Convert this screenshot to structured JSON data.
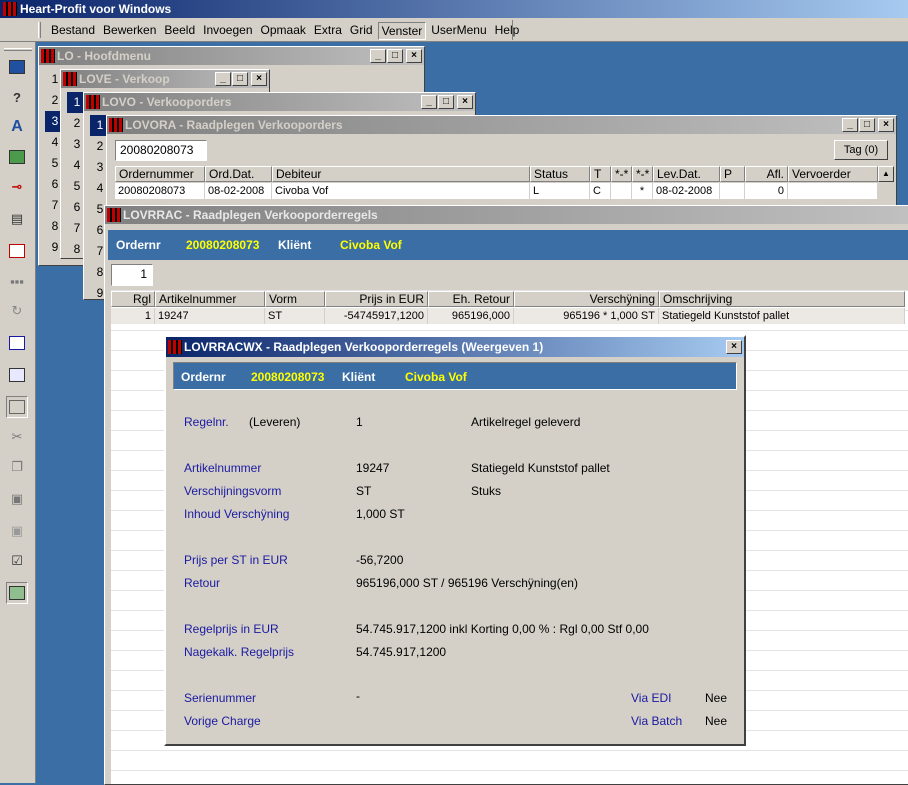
{
  "app": {
    "title": "Heart-Profit voor Windows"
  },
  "menu": {
    "items": [
      "Bestand",
      "Bewerken",
      "Beeld",
      "Invoegen",
      "Opmaak",
      "Extra",
      "Grid",
      "Venster",
      "UserMenu",
      "Help"
    ],
    "active_index": 7
  },
  "toolbar": {
    "icons": [
      "app-window-icon",
      "help-icon",
      "font-edit-icon",
      "switch-icon",
      "key-icon",
      "printer-icon",
      "form-icon",
      "dots-icon",
      "refresh-icon",
      "export-icon",
      "report-icon",
      "window-icon",
      "cut-icon",
      "copy-icon",
      "paste-icon",
      "paste-special-icon",
      "properties-icon",
      "screen-icon"
    ]
  },
  "windows": {
    "lo": {
      "title": "LO - Hoofdmenu",
      "numbers": [
        "1",
        "2",
        "3",
        "4",
        "5",
        "6",
        "7",
        "8",
        "9"
      ],
      "selected_index": 2
    },
    "love": {
      "title": "LOVE - Verkoop",
      "numbers": [
        "1",
        "2",
        "3",
        "4",
        "5",
        "6",
        "7",
        "8"
      ],
      "selected_index": 0
    },
    "lovo": {
      "title": "LOVO - Verkooporders",
      "numbers": [
        "1",
        "2",
        "3",
        "4",
        "5",
        "6",
        "7",
        "8",
        "9"
      ],
      "selected_index": 0
    },
    "lovora": {
      "title": "LOVORA - Raadplegen Verkooporders",
      "search_value": "20080208073",
      "tag_button": "Tag (0)",
      "columns": [
        "Ordernummer",
        "Ord.Dat.",
        "Debiteur",
        "Status",
        "T",
        "*-*",
        "*-*",
        "Lev.Dat.",
        "P",
        "Afl.",
        "Vervoerder"
      ],
      "row": [
        "20080208073",
        "08-02-2008",
        "Civoba Vof",
        "L",
        "C",
        "",
        "*",
        "08-02-2008",
        "",
        "0",
        ""
      ]
    },
    "lovrrac": {
      "title": "LOVRRAC - Raadplegen Verkooporderregels",
      "ordernr_label": "Ordernr",
      "ordernr_value": "20080208073",
      "klient_label": "Kliënt",
      "klient_value": "Civoba Vof",
      "page_value": "1",
      "columns": [
        "Rgl",
        "Artikelnummer",
        "Vorm",
        "Prijs in EUR",
        "Eh. Retour",
        "Verschÿning",
        "Omschrijving"
      ],
      "row": [
        "1",
        "19247",
        "ST",
        "-54745917,1200",
        "965196,000",
        "965196 * 1,000 ST",
        "Statiegeld Kunststof pallet"
      ]
    },
    "lovrracwx": {
      "title": "LOVRRACWX - Raadplegen Verkooporderregels (Weergeven 1)",
      "ordernr_label": "Ordernr",
      "ordernr_value": "20080208073",
      "klient_label": "Kliënt",
      "klient_value": "Civoba Vof",
      "regelnr_label": "Regelnr.",
      "regelnr_sub": "(Leveren)",
      "regelnr_value": "1",
      "regelnr_desc": "Artikelregel geleverd",
      "artikel_label": "Artikelnummer",
      "artikel_value": "19247",
      "artikel_desc": "Statiegeld Kunststof pallet",
      "vorm_label": "Verschijningsvorm",
      "vorm_value": "ST",
      "vorm_desc": "Stuks",
      "inhoud_label": "Inhoud Verschÿning",
      "inhoud_value": "1,000 ST",
      "prijs_label": "Prijs per ST in EUR",
      "prijs_value": "-56,7200",
      "retour_label": "Retour",
      "retour_value": "965196,000 ST / 965196 Verschÿning(en)",
      "regelprijs_label": "Regelprijs in EUR",
      "regelprijs_value": "54.745.917,1200 inkl Korting 0,00 % : Rgl 0,00 Stf 0,00",
      "nagekalk_label": "Nagekalk. Regelprijs",
      "nagekalk_value": "54.745.917,1200",
      "serie_label": "Serienummer",
      "serie_value": "-",
      "charge_label": "Vorige Charge",
      "via_edi_label": "Via EDI",
      "via_edi_value": "Nee",
      "via_batch_label": "Via Batch",
      "via_batch_value": "Nee"
    }
  }
}
